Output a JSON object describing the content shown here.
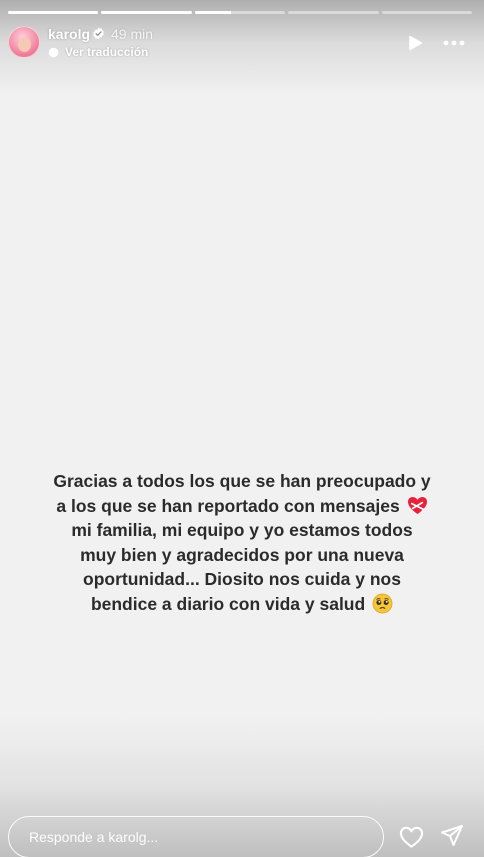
{
  "story": {
    "progress": [
      1,
      1,
      0.4,
      0,
      0
    ],
    "account": {
      "username": "karolg",
      "verified": true,
      "time_ago": "49 min"
    },
    "translate_label": "Ver traducción",
    "icons": {
      "avatar": "profile-photo",
      "verified": "verified-badge-icon",
      "translate": "translate-icon",
      "play": "play-icon",
      "more": "more-options-icon",
      "heart_emoji": "mending-heart-emoji",
      "pleading_emoji": "pleading-face-emoji",
      "like": "heart-outline-icon",
      "share": "send-paper-plane-icon"
    },
    "message_lines": [
      "Gracias a todos los que se han preocupado y",
      "a los que se han reportado con mensajes",
      "mi familia, mi equipo y yo estamos todos",
      "muy bien y agradecidos por una nueva",
      "oportunidad... Diosito nos cuida y nos",
      "bendice a diario con vida y salud"
    ],
    "reply": {
      "placeholder": "Responde a karolg...",
      "value": ""
    },
    "colors": {
      "background": "#f1f1f1",
      "text": "#2b2b2b",
      "heart_red": "#e8223a",
      "emoji_yellow": "#f7c638"
    }
  }
}
